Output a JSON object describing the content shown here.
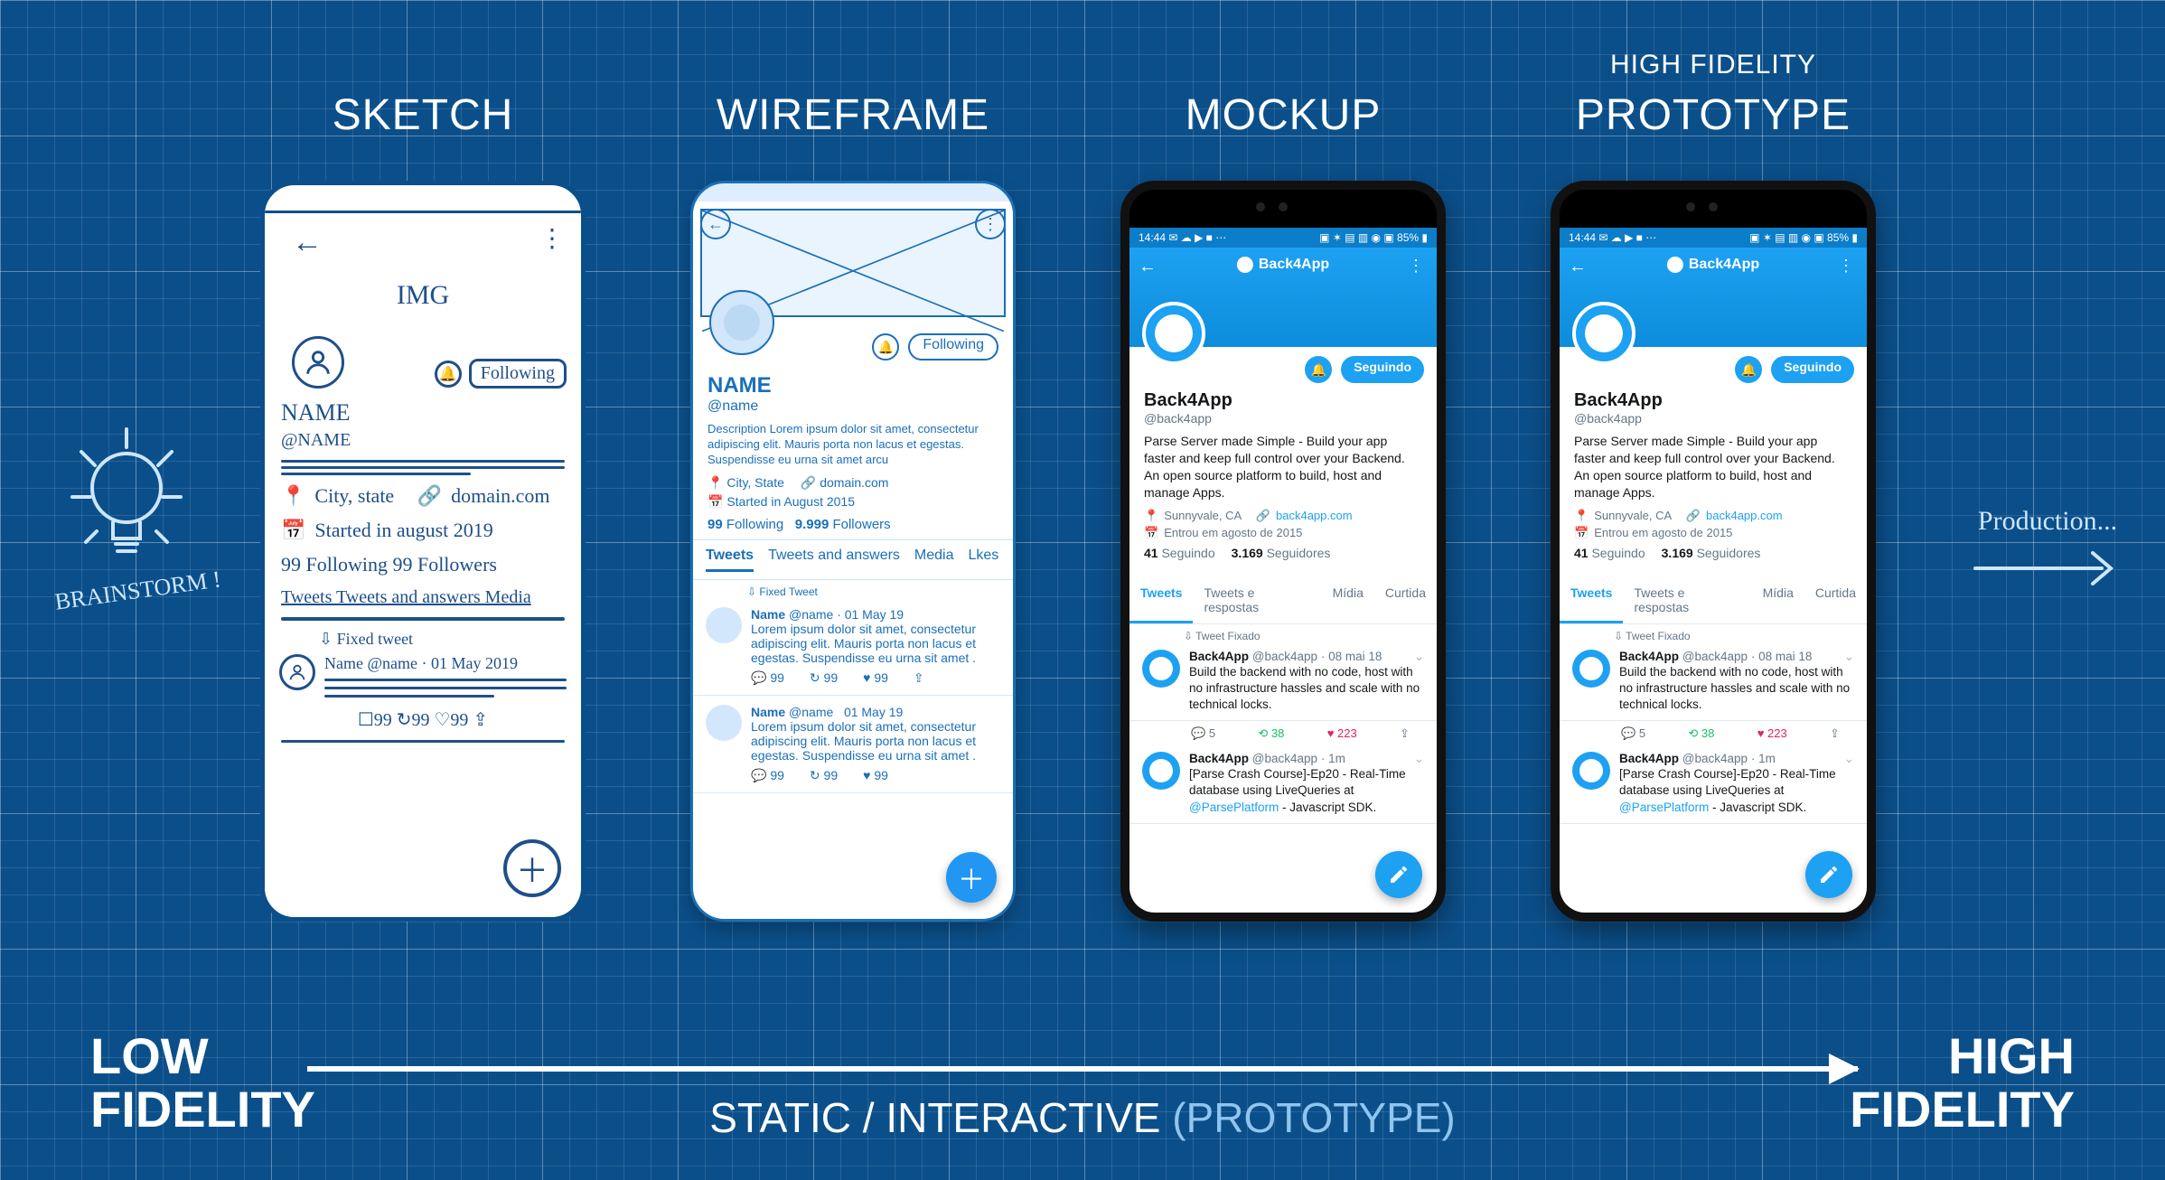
{
  "stages": {
    "sketch": "SKETCH",
    "wireframe": "WIREFRAME",
    "mockup": "MOCKUP",
    "proto_above": "HIGH FIDELITY",
    "proto": "PROTOTYPE"
  },
  "captions": {
    "low": "LOW FIDELITY",
    "high": "HIGH FIDELITY",
    "middle_static": "STATIC / INTERACTIVE ",
    "middle_proto": "(PROTOTYPE)",
    "brainstorm": "BRAINSTORM !",
    "production": "Production..."
  },
  "sketch": {
    "img": "IMG",
    "name": "NAME",
    "handle": "@NAME",
    "following_btn": "Following",
    "city": "City, state",
    "domain": "domain.com",
    "started": "Started in august 2019",
    "follow_counts": "99 Following   99 Followers",
    "tabs": "Tweets   Tweets and answers   Media",
    "fixed": "⇩ Fixed tweet",
    "tweet_line": "Name  @name · 01 May 2019",
    "actions": "☐99    ↻99    ♡99    ⇪"
  },
  "wireframe": {
    "name": "NAME",
    "handle": "@name",
    "following_btn": "Following",
    "desc": "Description Lorem ipsum dolor sit amet, consectetur adipiscing elit. Mauris porta non lacus et egestas. Suspendisse eu urna sit amet arcu",
    "city": "City, State",
    "domain": "domain.com",
    "started": "Started in August 2015",
    "following_n": "99",
    "following_lbl": "Following",
    "followers_n": "9.999",
    "followers_lbl": "Followers",
    "tabs": {
      "t1": "Tweets",
      "t2": "Tweets and answers",
      "t3": "Media",
      "t4": "Lkes"
    },
    "fixed": "⇩  Fixed Tweet",
    "tweet": {
      "name": "Name",
      "handle": "@name",
      "date": "01 May 19",
      "body": "Lorem ipsum dolor sit amet, consectetur adipiscing elit. Mauris porta non lacus et egestas. Suspendisse eu urna sit amet .",
      "c": "99",
      "r": "99",
      "l": "99"
    }
  },
  "mockup": {
    "status_left": "14:44  ✉ ☁ ▶ ■ ⋯",
    "status_right": "▣ ✶ ▤ ▥ ◉ ▣ 85% ▮",
    "brand": "Back4App",
    "name": "Back4App",
    "handle": "@back4app",
    "follow_btn": "Seguindo",
    "bio": "Parse Server made Simple - Build your app faster and keep full control over your Backend. An open source platform to build, host and manage Apps.",
    "loc": "Sunnyvale, CA",
    "link": "back4app.com",
    "joined": "Entrou em agosto de 2015",
    "following_n": "41",
    "following_lbl": "Seguindo",
    "followers_n": "3.169",
    "followers_lbl": "Seguidores",
    "tabs": {
      "t1": "Tweets",
      "t2": "Tweets e respostas",
      "t3": "Mídia",
      "t4": "Curtida"
    },
    "pin": "⇩  Tweet Fixado",
    "tweet1": {
      "name": "Back4App",
      "handle": "@back4app",
      "date": "08 mai 18",
      "body": "Build the backend with no code, host with no infrastructure hassles and scale with no technical locks.",
      "c": "5",
      "r": "38",
      "l": "223"
    },
    "tweet2": {
      "name": "Back4App",
      "handle": "@back4app",
      "date": "1m",
      "body_a": "[Parse Crash Course]-Ep20 - Real-Time database using LiveQueries at ",
      "mention": "@ParsePlatform",
      "body_b": " - Javascript SDK."
    }
  }
}
